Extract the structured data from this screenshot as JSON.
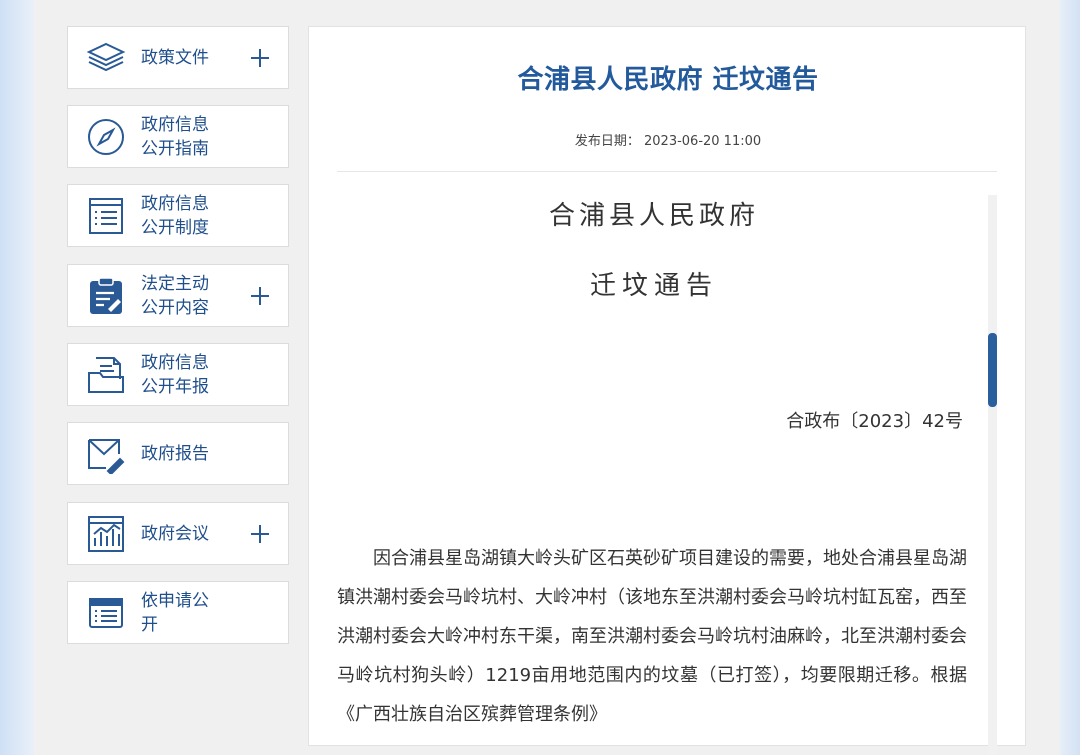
{
  "sidebar": {
    "items": [
      {
        "label": "政策文件",
        "icon": "layers-icon",
        "expandable": true
      },
      {
        "label": "政府信息\n公开指南",
        "icon": "compass-icon",
        "expandable": false
      },
      {
        "label": "政府信息\n公开制度",
        "icon": "list-document-icon",
        "expandable": false
      },
      {
        "label": "法定主动\n公开内容",
        "icon": "clipboard-edit-icon",
        "expandable": true
      },
      {
        "label": "政府信息\n公开年报",
        "icon": "folder-document-icon",
        "expandable": false
      },
      {
        "label": "政府报告",
        "icon": "envelope-pen-icon",
        "expandable": false
      },
      {
        "label": "政府会议",
        "icon": "chart-board-icon",
        "expandable": true
      },
      {
        "label": "依申请公\n开",
        "icon": "form-list-icon",
        "expandable": false
      }
    ]
  },
  "article": {
    "title": "合浦县人民政府 迁坟通告",
    "publish_date_label": "发布日期：",
    "publish_date": "2023-06-20 11:00",
    "doc_org": "合浦县人民政府",
    "doc_type": "迁坟通告",
    "doc_number": "合政布〔2023〕42号",
    "body": "因合浦县星岛湖镇大岭头矿区石英砂矿项目建设的需要，地处合浦县星岛湖镇洪潮村委会马岭坑村、大岭冲村（该地东至洪潮村委会马岭坑村缸瓦窑，西至洪潮村委会大岭冲村东干渠，南至洪潮村委会马岭坑村油麻岭，北至洪潮村委会马岭坑村狗头岭）1219亩用地范围内的坟墓（已打签），均要限期迁移。根据《广西壮族自治区殡葬管理条例》"
  },
  "colors": {
    "accent": "#225a9c",
    "label_blue": "#1f4e8c"
  }
}
